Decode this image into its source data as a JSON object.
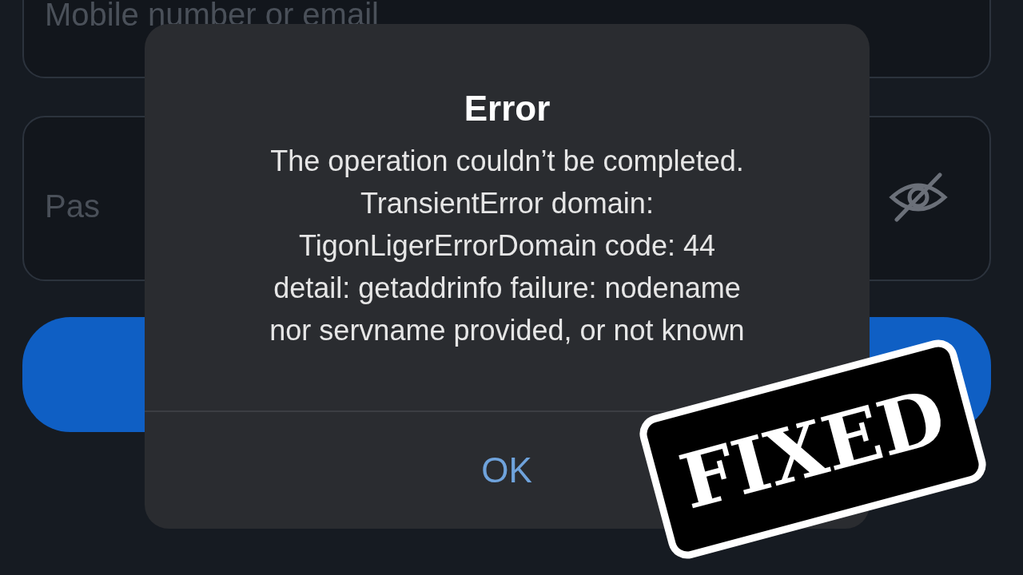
{
  "login_form": {
    "username_placeholder": "Mobile number or email",
    "password_placeholder": "Pas"
  },
  "alert": {
    "title": "Error",
    "message_lines": [
      "The operation couldn’t be completed.",
      "TransientError domain:",
      "TigonLigerErrorDomain code: 44",
      "detail: getaddrinfo failure: nodename",
      "nor servname provided, or not known"
    ],
    "button": "OK"
  },
  "stamp": {
    "text": "FIXED"
  }
}
